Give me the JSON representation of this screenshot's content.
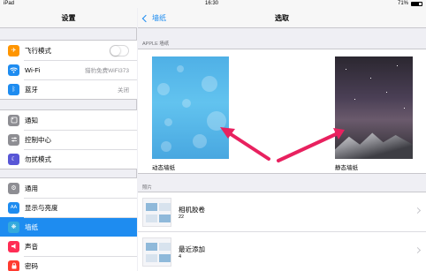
{
  "status": {
    "device": "iPad",
    "time": "16:30",
    "battery": "71%",
    "battery_level": 0.71
  },
  "settings": {
    "title": "设置",
    "groups": [
      {
        "items": [
          {
            "label": "飞行模式",
            "icon": "airplane-icon",
            "color": "#ff9500",
            "toggle": false
          },
          {
            "label": "Wi-Fi",
            "icon": "wifi-icon",
            "color": "#1e8cf0",
            "value": "猎豹免费WiFi373"
          },
          {
            "label": "蓝牙",
            "icon": "bluetooth-icon",
            "color": "#1e8cf0",
            "value": "关闭"
          }
        ]
      },
      {
        "items": [
          {
            "label": "通知",
            "icon": "notifications-icon",
            "color": "#8e8e93"
          },
          {
            "label": "控制中心",
            "icon": "control-center-icon",
            "color": "#8e8e93"
          },
          {
            "label": "勿扰模式",
            "icon": "moon-icon",
            "color": "#5856d6"
          }
        ]
      },
      {
        "items": [
          {
            "label": "通用",
            "icon": "gear-icon",
            "color": "#8e8e93"
          },
          {
            "label": "显示与亮度",
            "icon": "brightness-icon",
            "color": "#1e8cf0"
          },
          {
            "label": "墙纸",
            "icon": "wallpaper-icon",
            "color": "#34aadc",
            "selected": true
          },
          {
            "label": "声音",
            "icon": "speaker-icon",
            "color": "#ff2d55"
          },
          {
            "label": "密码",
            "icon": "lock-icon",
            "color": "#ff3b30"
          }
        ]
      }
    ]
  },
  "detail": {
    "back_label": "墙纸",
    "title": "选取",
    "apple_section": "APPLE 墙纸",
    "dynamic_label": "动态墙纸",
    "static_label": "静态墙纸",
    "photos_section": "照片",
    "albums": [
      {
        "name": "相机胶卷",
        "count": "22"
      },
      {
        "name": "最近添加",
        "count": "4"
      }
    ]
  },
  "colors": {
    "accent": "#1e8cf0",
    "arrow": "#e8215f"
  }
}
